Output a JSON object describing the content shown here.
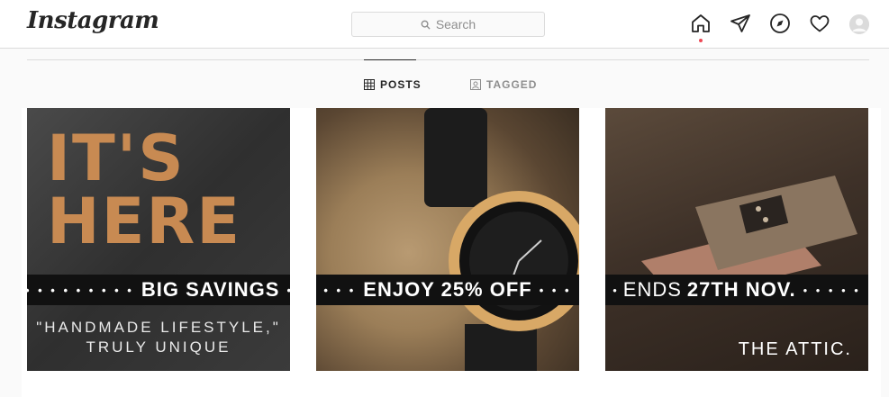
{
  "header": {
    "logo": "Instagram",
    "search_placeholder": "Search",
    "icons": [
      "home-icon",
      "direct-icon",
      "explore-icon",
      "activity-icon",
      "profile-avatar"
    ]
  },
  "tabs": [
    {
      "label": "POSTS",
      "icon": "grid-icon",
      "active": true
    },
    {
      "label": "TAGGED",
      "icon": "tagged-icon",
      "active": false
    }
  ],
  "posts": [
    {
      "headline_1": "IT'S",
      "headline_2": "HERE",
      "banner": "BIG SAVINGS",
      "quote_1": "\"HANDMADE LIFESTYLE,\"",
      "quote_2": "TRULY UNIQUE"
    },
    {
      "banner": "ENJOY 25% OFF"
    },
    {
      "banner_prefix": "ENDS",
      "banner_bold": "27TH NOV.",
      "brand": "THE ATTIC."
    }
  ],
  "colors": {
    "accent_red": "#ed4956",
    "border": "#dbdbdb",
    "text": "#262626",
    "muted": "#8e8e8e"
  }
}
